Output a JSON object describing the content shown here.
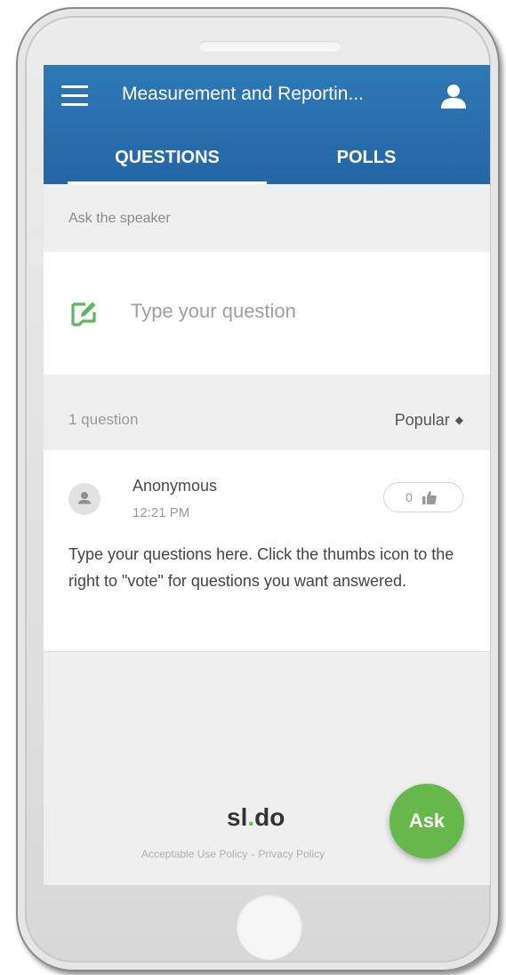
{
  "header": {
    "title": "Measurement and Reportin...",
    "menu_icon": "hamburger-menu-icon",
    "user_icon": "user-icon",
    "color": "#2a6fae"
  },
  "tabs": [
    {
      "label": "QUESTIONS",
      "active": true
    },
    {
      "label": "POLLS",
      "active": false
    }
  ],
  "compose": {
    "section_label": "Ask the speaker",
    "placeholder": "Type your question",
    "icon": "edit-icon",
    "icon_color": "#5cb85c"
  },
  "questions_bar": {
    "count_label": "1 question",
    "sort_label": "Popular",
    "sort_icon": "sort-icon"
  },
  "questions": [
    {
      "author": "Anonymous",
      "time": "12:21 PM",
      "votes": "0",
      "text": "Type your questions here. Click the thumbs icon to the right to \"vote\" for questions you want answered."
    }
  ],
  "footer": {
    "logo_prefix": "sl",
    "logo_dot": ".",
    "logo_suffix": "do",
    "link_policy": "Acceptable Use Policy",
    "separator": "-",
    "link_privacy": "Privacy Policy"
  },
  "ask_button": {
    "label": "Ask",
    "color": "#67b84a"
  }
}
